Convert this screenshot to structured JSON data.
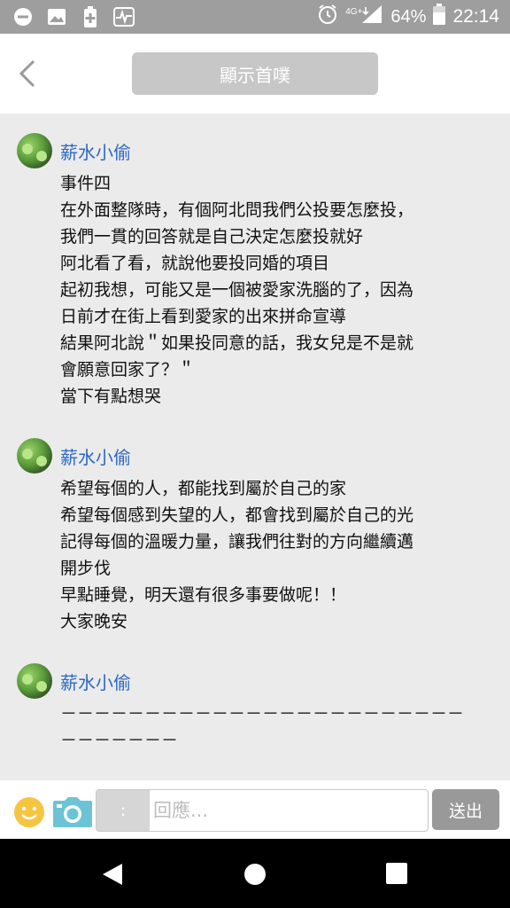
{
  "status_bar": {
    "network": "4G+",
    "battery": "64%",
    "time": "22:14",
    "icons": [
      "minus-circle-icon",
      "image-icon",
      "battery-plus-icon",
      "pulse-icon",
      "alarm-icon",
      "signal-icon",
      "battery-icon"
    ]
  },
  "header": {
    "back_icon": "chevron-left-icon",
    "show_first_label": "顯示首噗"
  },
  "posts": [
    {
      "author": "薪水小偷",
      "lines": [
        "事件四",
        "在外面整隊時，有個阿北問我們公投要怎麼投，",
        "我們一貫的回答就是自己決定怎麼投就好",
        "阿北看了看，就說他要投同婚的項目",
        "起初我想，可能又是一個被愛家洗腦的了，因為",
        "日前才在街上看到愛家的出來拼命宣導",
        "結果阿北說＂如果投同意的話，我女兒是不是就",
        "會願意回家了？＂",
        "當下有點想哭"
      ]
    },
    {
      "author": "薪水小偷",
      "lines": [
        "希望每個的人，都能找到屬於自己的家",
        "希望每個感到失望的人，都會找到屬於自己的光",
        "記得每個的溫暖力量，讓我們往對的方向繼續邁",
        "開步伐",
        "早點睡覺，明天還有很多事要做呢！！",
        "大家晚安"
      ]
    },
    {
      "author": "薪水小偷",
      "lines": [
        "－－－－－－－－－－－－－－－－－－－－－－－－",
        "－－－－－－－"
      ]
    }
  ],
  "reply_bar": {
    "emoji_icon": "smiley-icon",
    "camera_icon": "camera-icon",
    "qualifier": ":",
    "placeholder": "回應...",
    "send_label": "送出"
  },
  "nav_bar": {
    "icons": [
      "back-triangle-icon",
      "home-circle-icon",
      "recent-square-icon"
    ]
  },
  "colors": {
    "status_bar": "#9e9e9e",
    "feed_bg": "#ebebeb",
    "author": "#2d68c4",
    "show_first_button": "#c7c7c7",
    "send_button": "#999999",
    "smiley": "#f5c542",
    "camera": "#6cc3d5"
  }
}
